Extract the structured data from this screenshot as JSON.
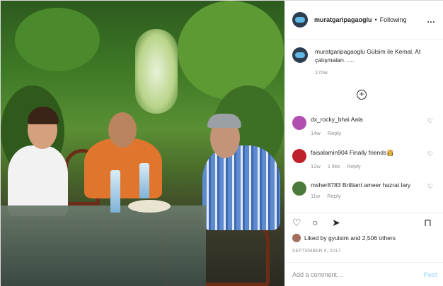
{
  "post": {
    "username": "muratgaripagaoglu",
    "follow_status": "Following",
    "separator": "•",
    "more_icon": "…",
    "caption_user": "muratgaripagaoglu",
    "caption_text": "Gülsim ile Kemal. At çalışmaları. ....",
    "caption_time": "170w",
    "load_more_icon": "+"
  },
  "comments": [
    {
      "user": "dx_rocky_bhai",
      "text": "Aala",
      "time": "14w",
      "likes": "",
      "reply": "Reply",
      "avatar_color": "#b04fb0"
    },
    {
      "user": "faisalamin904",
      "text": "Finally friends👸",
      "time": "12w",
      "likes": "1 like",
      "reply": "Reply",
      "avatar_color": "#c0202a"
    },
    {
      "user": "msher8783",
      "text": "Brilliant ameer hazrat lary",
      "time": "11w",
      "likes": "",
      "reply": "Reply",
      "avatar_color": "#4a7a3a"
    }
  ],
  "actions": {
    "like_icon": "♡",
    "comment_icon": "○",
    "share_icon": "➤",
    "save_icon": "⊓",
    "likes_text": "Liked by gyulsim and 2,506 others",
    "date": "SEPTEMBER 9, 2017"
  },
  "add_comment": {
    "placeholder": "Add a comment…",
    "post_label": "Post"
  },
  "colors": {
    "link_disabled": "#b2dffc",
    "muted": "#8e8e8e",
    "border": "#efefef"
  }
}
